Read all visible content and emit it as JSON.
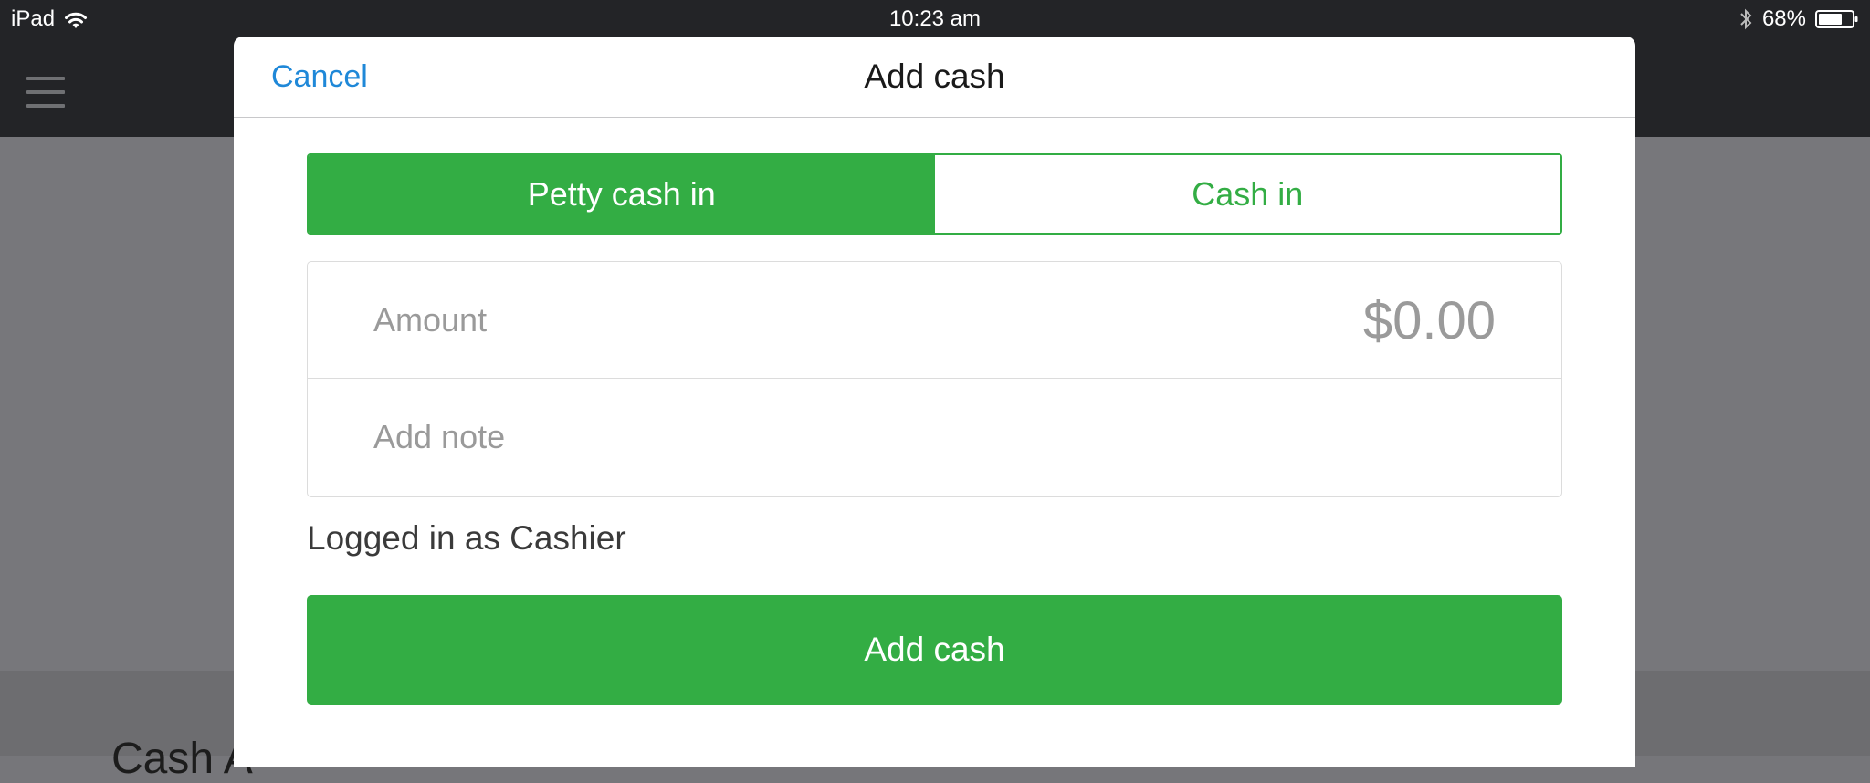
{
  "status_bar": {
    "device": "iPad",
    "time": "10:23 am",
    "battery": "68%",
    "icons": [
      "wifi-icon",
      "bluetooth-icon",
      "battery-icon"
    ]
  },
  "background": {
    "lower_text": "Cash A"
  },
  "modal": {
    "title": "Add cash",
    "cancel_label": "Cancel",
    "segments": [
      {
        "label": "Petty cash in",
        "selected": true
      },
      {
        "label": "Cash in",
        "selected": false
      }
    ],
    "form": {
      "amount_label": "Amount",
      "amount_value": "$0.00",
      "note_placeholder": "Add note",
      "note_value": ""
    },
    "logged_in_text": "Logged in as Cashier",
    "submit_label": "Add cash"
  },
  "colors": {
    "accent_green": "#33ad44",
    "link_blue": "#1f88d8",
    "navbar_dark": "#232427",
    "overlay_gray": "#77777b"
  }
}
